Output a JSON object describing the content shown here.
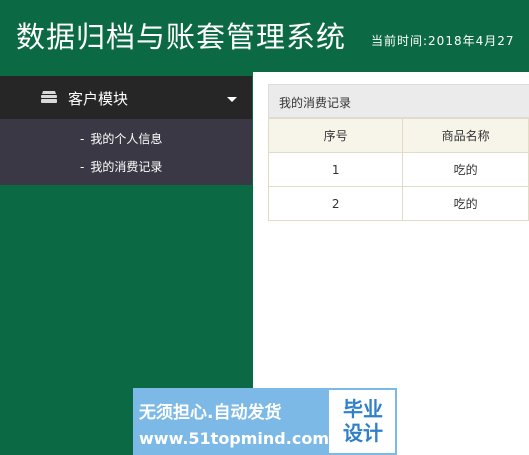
{
  "app": {
    "title": "数据归档与账套管理系统",
    "datetime": "当前时间:2018年4月27"
  },
  "sidebar": {
    "module_label": "客户模块",
    "items": [
      {
        "label": "我的个人信息"
      },
      {
        "label": "我的消费记录"
      }
    ]
  },
  "main": {
    "panel_title": "我的消费记录",
    "table": {
      "headers": [
        "序号",
        "商品名称"
      ],
      "rows": [
        [
          "1",
          "吃的"
        ],
        [
          "2",
          "吃的"
        ]
      ]
    }
  },
  "watermark": {
    "line1": "无须担心.自动发货",
    "line2": "www.51topmind.com",
    "box": "毕业设计"
  }
}
